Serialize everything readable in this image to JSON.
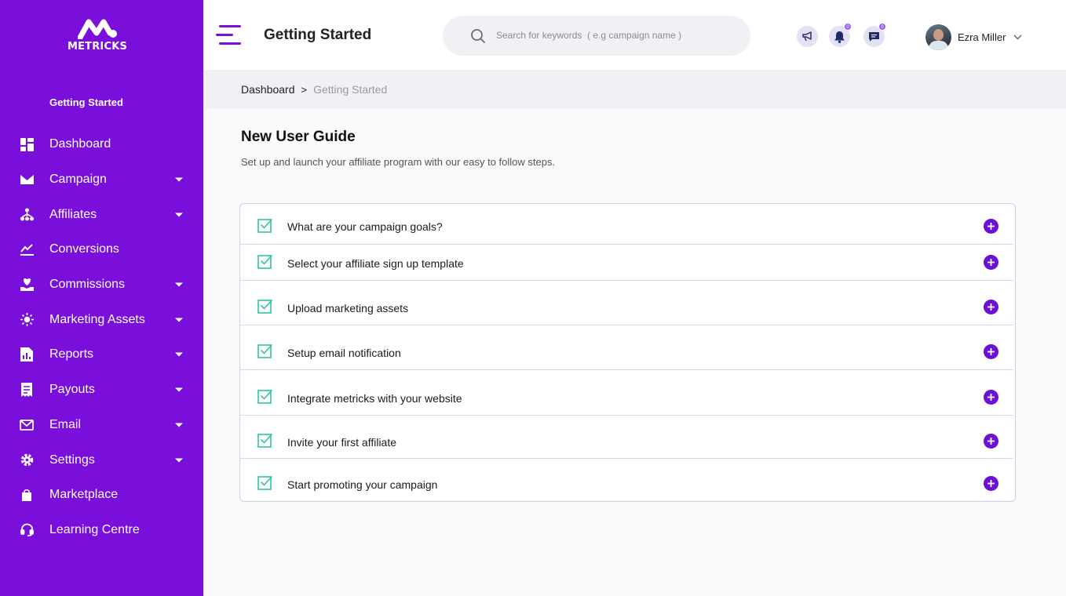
{
  "brand": {
    "name": "METRICKS",
    "accent": "#7a0fdc"
  },
  "sidebar": {
    "section_label": "Getting Started",
    "items": [
      {
        "label": "Dashboard",
        "icon": "dashboard-icon",
        "has_caret": false
      },
      {
        "label": "Campaign",
        "icon": "campaign-icon",
        "has_caret": true
      },
      {
        "label": "Affiliates",
        "icon": "affiliates-icon",
        "has_caret": true
      },
      {
        "label": "Conversions",
        "icon": "conversions-icon",
        "has_caret": false
      },
      {
        "label": "Commissions",
        "icon": "commissions-icon",
        "has_caret": true
      },
      {
        "label": "Marketing Assets",
        "icon": "marketing-assets-icon",
        "has_caret": true
      },
      {
        "label": "Reports",
        "icon": "reports-icon",
        "has_caret": true
      },
      {
        "label": "Payouts",
        "icon": "payouts-icon",
        "has_caret": true
      },
      {
        "label": "Email",
        "icon": "email-icon",
        "has_caret": true
      },
      {
        "label": "Settings",
        "icon": "settings-icon",
        "has_caret": true
      },
      {
        "label": "Marketplace",
        "icon": "marketplace-icon",
        "has_caret": false
      },
      {
        "label": "Learning Centre",
        "icon": "headset-icon",
        "has_caret": false
      }
    ]
  },
  "header": {
    "title": "Getting Started",
    "search": {
      "placeholder": "Search for keywords  ( e.g campaign name )",
      "value": ""
    },
    "icons": {
      "announcements": {
        "icon": "megaphone-icon"
      },
      "notifications": {
        "icon": "bell-icon",
        "badge": "0"
      },
      "messages": {
        "icon": "chat-icon",
        "badge": "0"
      }
    },
    "user": {
      "name": "Ezra Miller"
    }
  },
  "breadcrumb": {
    "root": "Dashboard",
    "separator": ">",
    "current": "Getting Started"
  },
  "guide": {
    "title": "New User Guide",
    "subtitle": "Set up and launch your affiliate program with our easy to follow steps.",
    "steps": [
      {
        "label": "What are your campaign goals?"
      },
      {
        "label": "Select your affiliate sign up template"
      },
      {
        "label": "Upload marketing assets"
      },
      {
        "label": "Setup email notification"
      },
      {
        "label": "Integrate metricks with your website"
      },
      {
        "label": "Invite your first affiliate"
      },
      {
        "label": "Start promoting your campaign"
      }
    ]
  },
  "colors": {
    "check": "#2ec4a0",
    "plus": "#6d10d6"
  }
}
